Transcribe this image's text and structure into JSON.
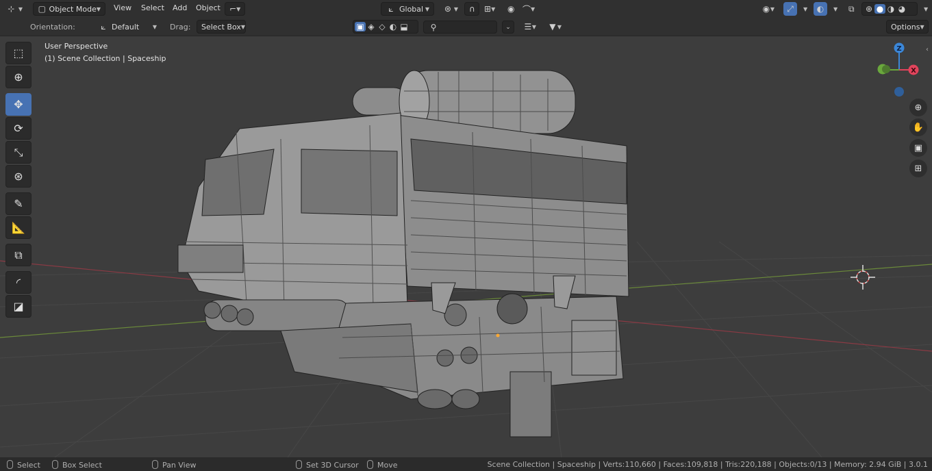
{
  "header": {
    "mode_label": "Object Mode",
    "menus": [
      "View",
      "Select",
      "Add",
      "Object"
    ],
    "transform_orientation": "Global",
    "options_label": "Options"
  },
  "tool_settings": {
    "orientation_label": "Orientation:",
    "orientation_value": "Default",
    "drag_label": "Drag:",
    "drag_value": "Select Box",
    "search_placeholder": ""
  },
  "viewport": {
    "perspective_label": "User Perspective",
    "collection_label": "(1) Scene Collection | Spaceship",
    "gizmo": {
      "z": "Z",
      "x": "X"
    }
  },
  "toolbar": {
    "tools": [
      "select-box",
      "cursor",
      "move",
      "rotate",
      "scale",
      "transform",
      "annotate",
      "measure",
      "add-cube",
      "shear",
      "bevel"
    ]
  },
  "statusbar": {
    "select": "Select",
    "box_select": "Box Select",
    "pan_view": "Pan View",
    "set_cursor": "Set 3D Cursor",
    "move": "Move",
    "stats": "Scene Collection | Spaceship | Verts:110,660 | Faces:109,818 | Tris:220,188 | Objects:0/13 | Memory: 2.94 GiB | 3.0.1"
  },
  "colors": {
    "accent": "#4772b3",
    "axis_x": "#e2445c",
    "axis_y": "#6aa83d",
    "axis_z": "#3b87d8"
  }
}
